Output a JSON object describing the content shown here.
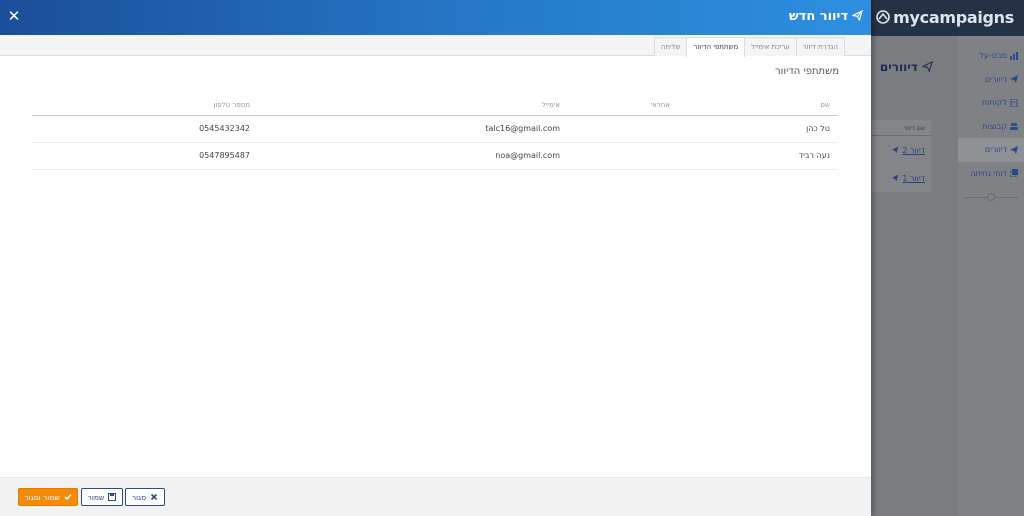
{
  "app": {
    "brand": "mycampaigns",
    "page_title": "דיוורים",
    "sidebar": [
      {
        "label": "מבט-על",
        "icon": "chart-icon"
      },
      {
        "label": "דיוורים",
        "icon": "send-icon"
      },
      {
        "label": "לקוחות",
        "icon": "contacts-icon"
      },
      {
        "label": "קבוצות",
        "icon": "group-icon"
      },
      {
        "label": "דיוורים",
        "icon": "send-icon",
        "active": true
      },
      {
        "label": "דוחי נחיתה",
        "icon": "copy-icon"
      }
    ],
    "list": {
      "header": "שם דיוור",
      "rows": [
        "דיוור 2",
        "דיוור 1"
      ]
    }
  },
  "modal": {
    "title": "דיוור חדש",
    "tabs": [
      {
        "label": "הגדרת דיוור",
        "active": false
      },
      {
        "label": "עריכת אימייל",
        "active": false
      },
      {
        "label": "משתתפי הדיוור",
        "active": true
      },
      {
        "label": "שליחה",
        "active": false
      }
    ],
    "section_title": "משתתפי הדיוור",
    "table": {
      "columns": [
        "שם",
        "אחראי",
        "אימייל",
        "מספר טלפון"
      ],
      "rows": [
        {
          "name": "טל כהן",
          "responsible": "",
          "email": "talc16@gmail.com",
          "phone": "0545432342"
        },
        {
          "name": "נעה רביד",
          "responsible": "",
          "email": "noa@gmail.com",
          "phone": "0547895487"
        }
      ]
    },
    "buttons": {
      "save_close": "שמור וסגור",
      "save": "שמור",
      "close": "סגור"
    }
  },
  "colors": {
    "header_start": "#1b4e9a",
    "header_end": "#2e8fe0",
    "accent_orange": "#f28a0b",
    "brand_navy": "#2b4a8a"
  }
}
